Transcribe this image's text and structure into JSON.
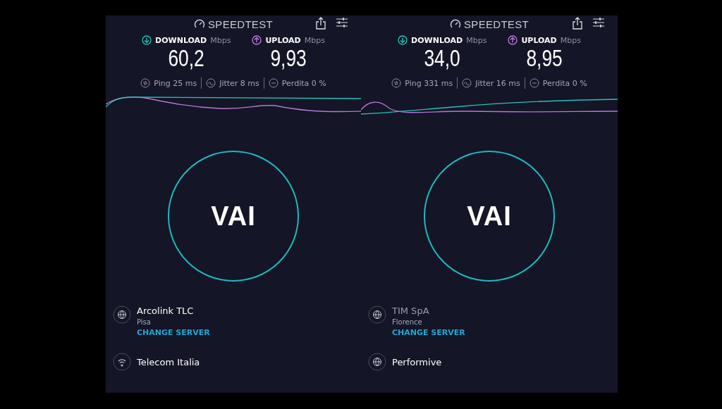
{
  "panels": [
    {
      "logo": "SPEEDTEST",
      "download": {
        "label": "DOWNLOAD",
        "unit": "Mbps",
        "value": "60,2"
      },
      "upload": {
        "label": "UPLOAD",
        "unit": "Mbps",
        "value": "9,93"
      },
      "stats": [
        {
          "kind": "ping",
          "text": "Ping 25 ms"
        },
        {
          "kind": "jitter",
          "text": "Jitter 8 ms"
        },
        {
          "kind": "loss",
          "text": "Perdita 0 %"
        }
      ],
      "go_button": "VAI",
      "server": {
        "name": "Arcolink TLC",
        "dimmed": false,
        "city": "Pisa",
        "link": "CHANGE SERVER"
      },
      "provider": {
        "kind": "wifi",
        "name": "Telecom Italia"
      }
    },
    {
      "logo": "SPEEDTEST",
      "download": {
        "label": "DOWNLOAD",
        "unit": "Mbps",
        "value": "34,0"
      },
      "upload": {
        "label": "UPLOAD",
        "unit": "Mbps",
        "value": "8,95"
      },
      "stats": [
        {
          "kind": "ping",
          "text": "Ping 331 ms"
        },
        {
          "kind": "jitter",
          "text": "Jitter 16 ms"
        },
        {
          "kind": "loss",
          "text": "Perdita 0 %"
        }
      ],
      "go_button": "VAI",
      "server": {
        "name": "TIM SpA",
        "dimmed": true,
        "city": "Florence",
        "link": "CHANGE SERVER"
      },
      "provider": {
        "kind": "globe",
        "name": "Performive"
      }
    }
  ]
}
